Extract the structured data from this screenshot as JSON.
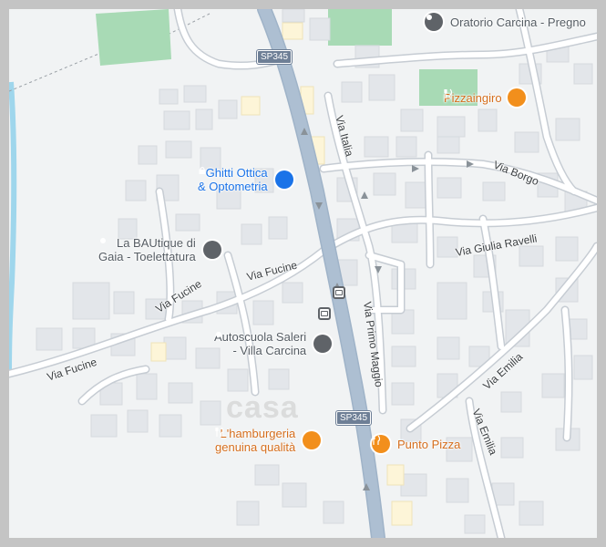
{
  "pois": [
    {
      "id": "oratorio",
      "name": "Oratorio Carcina - Pregno",
      "category": "place",
      "color": "#5f6368",
      "icon": "place-pin-icon"
    },
    {
      "id": "pizzaingiro",
      "name": "Pizzaingiro",
      "category": "restaurant",
      "color": "#f28f1c",
      "icon": "fork-knife-icon"
    },
    {
      "id": "ghitti",
      "name": "Ghitti Ottica\n& Optometria",
      "category": "shopping",
      "color": "#1a73e8",
      "icon": "shopping-bag-icon"
    },
    {
      "id": "bautique",
      "name": "La BAUtique di\nGaia - Toelettatura",
      "category": "place",
      "color": "#5f6368",
      "icon": "place-pin-icon"
    },
    {
      "id": "autoscuola",
      "name": "Autoscuola Saleri\n- Villa Carcina",
      "category": "place",
      "color": "#5f6368",
      "icon": "place-pin-icon"
    },
    {
      "id": "hamburgeria",
      "name": "L'hamburgeria\ngenuina qualità",
      "category": "restaurant",
      "color": "#f28f1c",
      "icon": "fork-knife-icon"
    },
    {
      "id": "puntopizza",
      "name": "Punto Pizza",
      "category": "restaurant",
      "color": "#f28f1c",
      "icon": "fork-knife-icon"
    }
  ],
  "roads": {
    "via_italia": "Via Italia",
    "via_borgo": "Via Borgo",
    "via_giulia_ravelli": "Via Giulia Ravelli",
    "via_fucine_1": "Via Fucine",
    "via_fucine_2": "Via Fucine",
    "via_fucine_3": "Via Fucine",
    "via_primo_maggio": "Via Primo Maggio",
    "via_emilia_1": "Via Emilia",
    "via_emilia_2": "Via Emilia"
  },
  "shields": {
    "sp345_top": "SP345",
    "sp345_bottom": "SP345"
  },
  "watermark": "casa",
  "colors": {
    "background": "#f1f3f4",
    "building": "#e3e6ea",
    "road": "#ffffff",
    "road_casing": "#c6ccd3",
    "main_road": "#adbfd2",
    "park": "#a8dab5",
    "water": "#9fd6ec"
  }
}
